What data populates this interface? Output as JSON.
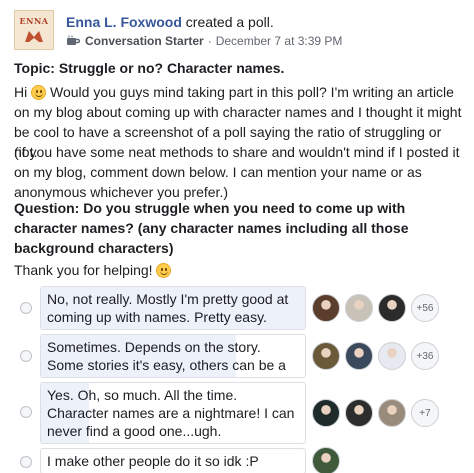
{
  "post": {
    "author": "Enna L. Foxwood",
    "action": "created a poll.",
    "topic_tag": "Conversation Starter",
    "separator": "·",
    "timestamp": "December 7 at 3:39 PM",
    "avatar_text": "ENNA"
  },
  "body": {
    "topic": "Topic: Struggle or no? Character names.",
    "para1_a": "Hi",
    "para1_b": "Would you guys mind taking part in this poll? I'm writing an article on my blog about coming up with character names and I thought it might be cool to have a screenshot of a poll saying the ratio of struggling or not.",
    "para2": "(if you have some neat methods to share and wouldn't mind if I posted it on my blog, comment down below. I can mention your name or as anonymous whichever you prefer.)",
    "question": "Question: Do you struggle when you need to come up with character names? (any character names including all those background characters)",
    "thanks": "Thank you for helping!"
  },
  "poll": {
    "options": [
      {
        "label": "No, not really. Mostly I'm pretty good at coming up with names. Pretty easy.",
        "fill": 1.0,
        "voter_colors": [
          "#5a3d2b",
          "#c9c2b8",
          "#2b2b2b"
        ],
        "more": "+56"
      },
      {
        "label": "Sometimes. Depends on the story. Some stories it's easy, others can be a struggle.",
        "fill": 0.74,
        "voter_colors": [
          "#6b5a3a",
          "#3a4a5c",
          "#e7eaf0"
        ],
        "more": "+36"
      },
      {
        "label": "Yes. Oh, so much. All the time. Character names are a nightmare! I can never find a good one...ugh.",
        "fill": 0.18,
        "voter_colors": [
          "#1f2a2a",
          "#2d2d2d",
          "#9a8c7c"
        ],
        "more": "+7"
      },
      {
        "label": "I make other people do it so idk :P",
        "fill": 0.0,
        "voter_colors": [
          "#3e5a3a"
        ],
        "more": ""
      }
    ]
  }
}
